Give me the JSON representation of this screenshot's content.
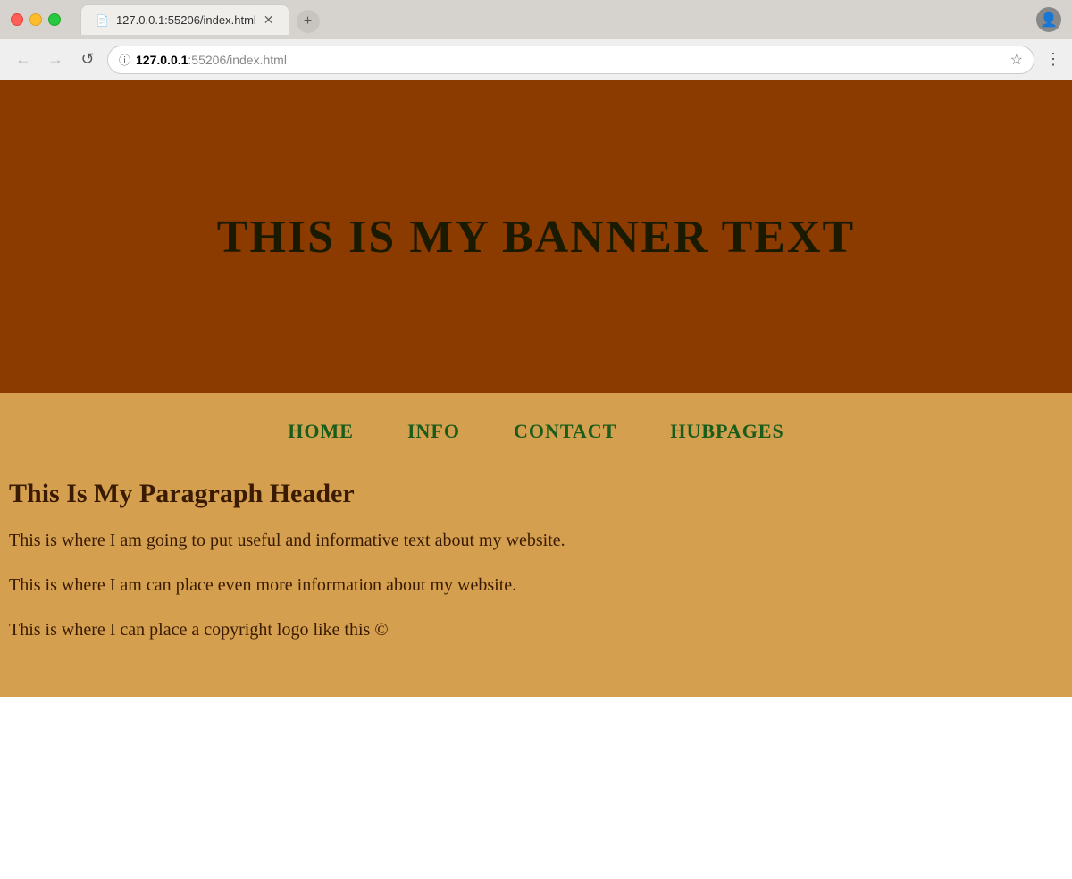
{
  "browser": {
    "url_highlight": "127.0.0.1",
    "url_dim": ":55206/index.html",
    "url_full": "127.0.0.1:55206/index.html",
    "tab_title": "127.0.0.1:55206/index.html",
    "back_label": "←",
    "forward_label": "→",
    "reload_label": "↺",
    "menu_label": "⋮",
    "profile_icon": "👤"
  },
  "website": {
    "banner_text": "THIS IS MY BANNER TEXT",
    "nav": {
      "home": "HOME",
      "info": "INFO",
      "contact": "CONTACT",
      "hubpages": "HUBPAGES"
    },
    "paragraph_header": "This Is My Paragraph Header",
    "paragraph1": "This is where I am going to put useful and informative text about my website.",
    "paragraph2": "This is where I am can place even more information about my website.",
    "paragraph3": "This is where I can place a copyright logo like this ©"
  }
}
